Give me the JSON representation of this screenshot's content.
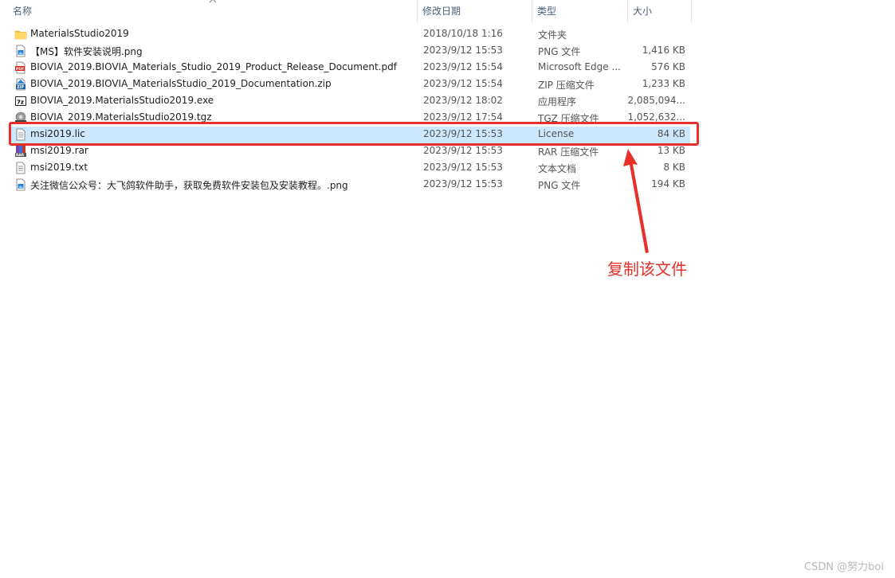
{
  "columns": {
    "name": "名称",
    "date": "修改日期",
    "type": "类型",
    "size": "大小"
  },
  "files": [
    {
      "icon": "folder-icon",
      "name": "MaterialsStudio2019",
      "date": "2018/10/18 1:16",
      "type": "文件夹",
      "size": ""
    },
    {
      "icon": "png-file-icon",
      "name": "【MS】软件安装说明.png",
      "date": "2023/9/12 15:53",
      "type": "PNG 文件",
      "size": "1,416 KB"
    },
    {
      "icon": "pdf-file-icon",
      "name": "BIOVIA_2019.BIOVIA_Materials_Studio_2019_Product_Release_Document.pdf",
      "date": "2023/9/12 15:54",
      "type": "Microsoft Edge ...",
      "size": "576 KB"
    },
    {
      "icon": "zip-file-icon",
      "name": "BIOVIA_2019.BIOVIA_MaterialsStudio_2019_Documentation.zip",
      "date": "2023/9/12 15:54",
      "type": "ZIP 压缩文件",
      "size": "1,233 KB"
    },
    {
      "icon": "7z-exe-icon",
      "name": "BIOVIA_2019.MaterialsStudio2019.exe",
      "date": "2023/9/12 18:02",
      "type": "应用程序",
      "size": "2,085,094..."
    },
    {
      "icon": "tgz-file-icon",
      "name": "BIOVIA_2019.MaterialsStudio2019.tgz",
      "date": "2023/9/12 17:54",
      "type": "TGZ 压缩文件",
      "size": "1,052,632..."
    },
    {
      "icon": "text-file-icon",
      "name": "msi2019.lic",
      "date": "2023/9/12 15:53",
      "type": "License",
      "size": "84 KB"
    },
    {
      "icon": "rar-file-icon",
      "name": "msi2019.rar",
      "date": "2023/9/12 15:53",
      "type": "RAR 压缩文件",
      "size": "13 KB"
    },
    {
      "icon": "text-file-icon",
      "name": "msi2019.txt",
      "date": "2023/9/12 15:53",
      "type": "文本文档",
      "size": "8 KB"
    },
    {
      "icon": "png-file-icon",
      "name": "关注微信公众号：大飞鸽软件助手，获取免费软件安装包及安装教程。.png",
      "date": "2023/9/12 15:53",
      "type": "PNG 文件",
      "size": "194 KB"
    }
  ],
  "selected_file": "msi2019.lic",
  "annotation": "复制该文件",
  "watermark": "CSDN @努力boi",
  "colors": {
    "highlight": "#e8302a",
    "selection": "#cce8ff",
    "header_text": "#4c607a"
  }
}
